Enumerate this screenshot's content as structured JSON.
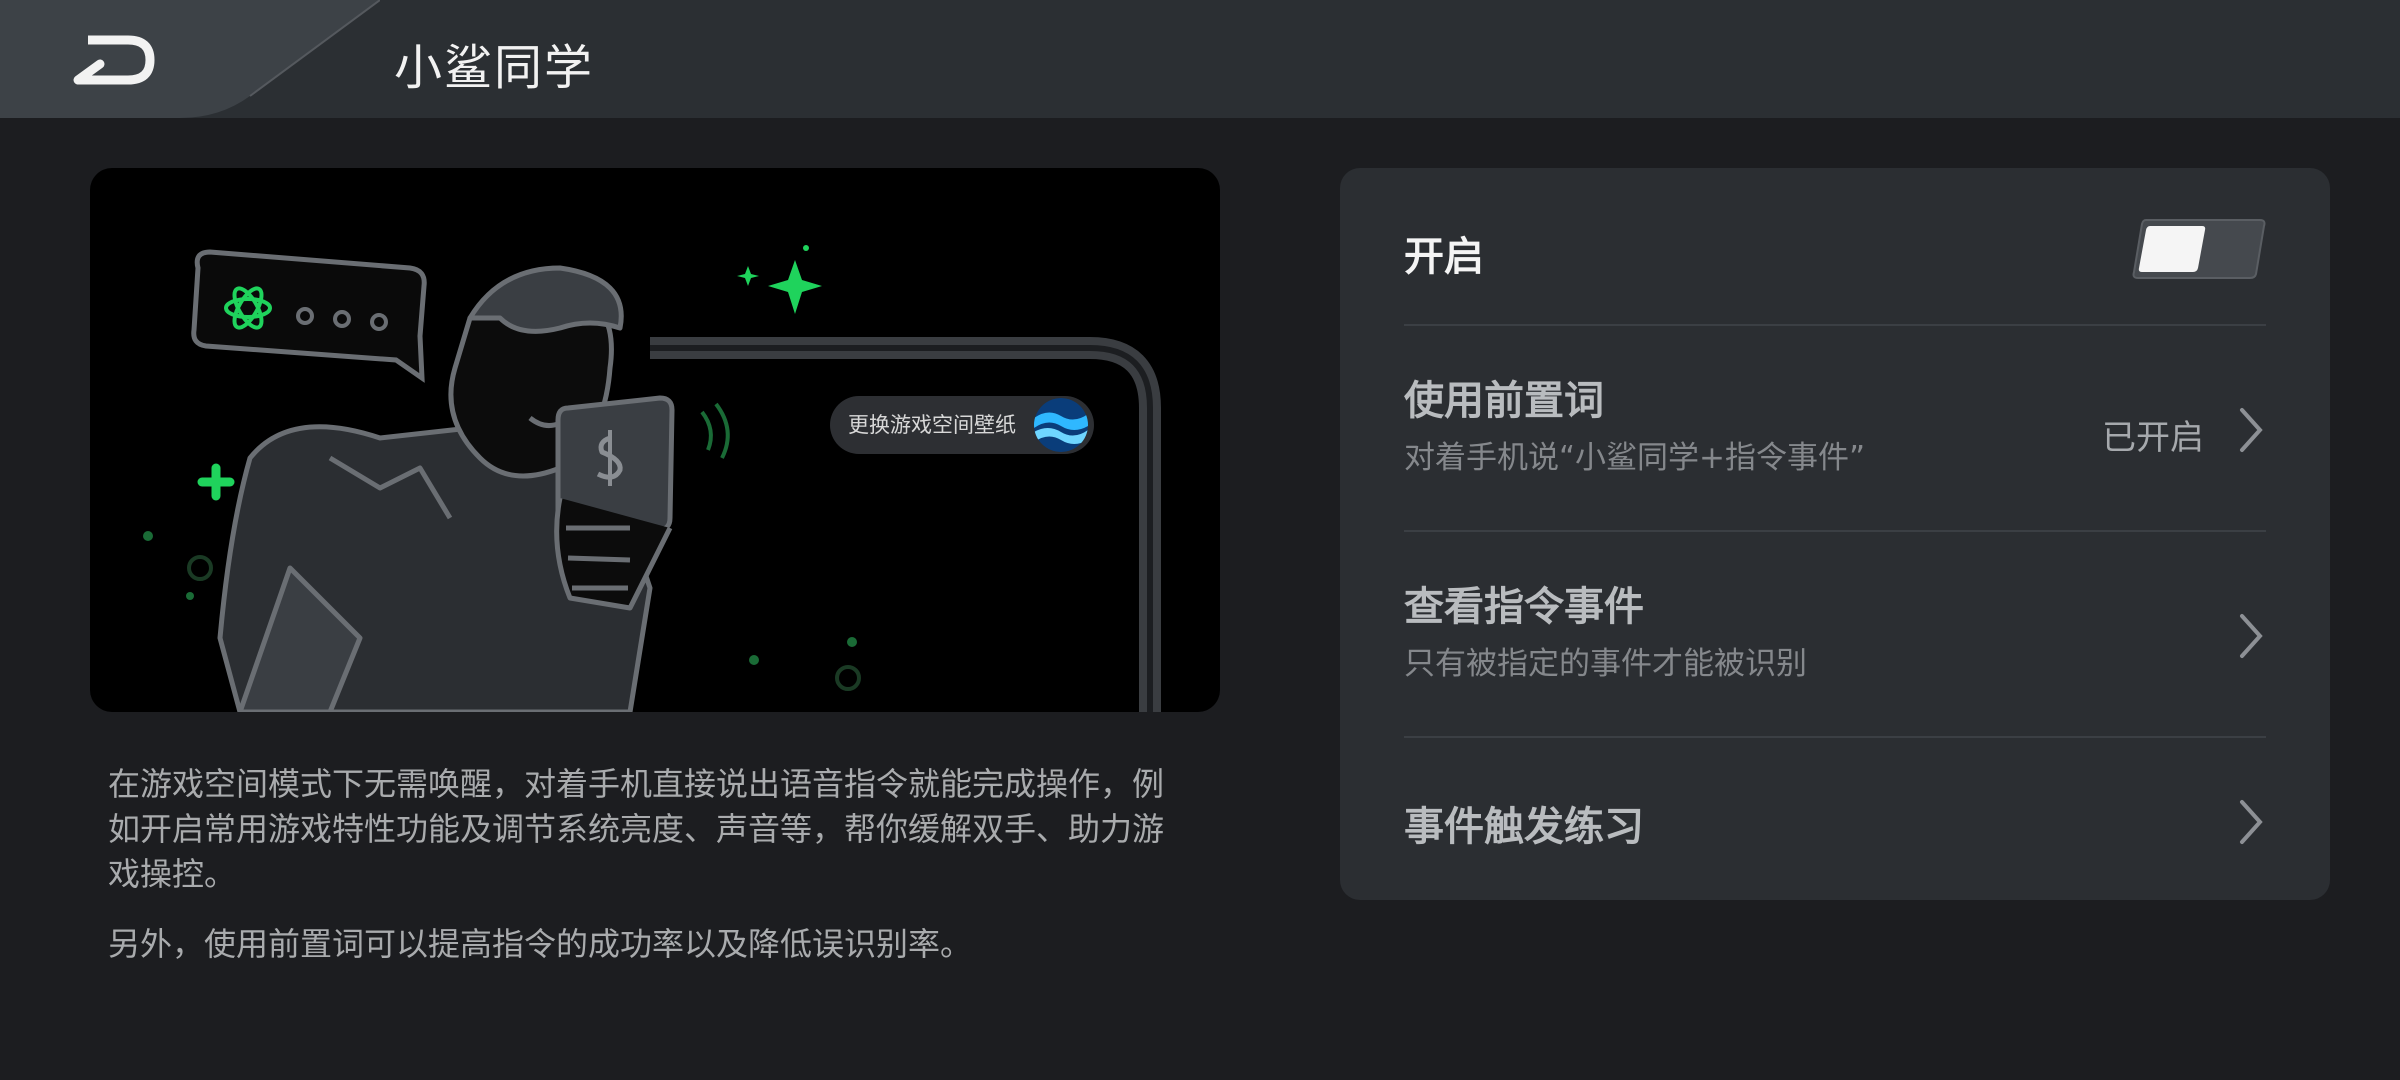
{
  "header": {
    "title": "小鲨同学",
    "back_icon": "back-arrow-icon"
  },
  "illustration": {
    "wallpaper_chip_label": "更换游戏空间壁纸"
  },
  "description": {
    "paragraph1": "在游戏空间模式下无需唤醒，对着手机直接说出语音指令就能完成操作，例如开启常用游戏特性功能及调节系统亮度、声音等，帮你缓解双手、助力游戏操控。",
    "paragraph2": "另外，使用前置词可以提高指令的成功率以及降低误识别率。"
  },
  "settings": {
    "toggle": {
      "label": "开启",
      "state": "off"
    },
    "items": [
      {
        "title": "使用前置词",
        "subtitle": "对着手机说“小鲨同学+指令事件”",
        "status": "已开启"
      },
      {
        "title": "查看指令事件",
        "subtitle": "只有被指定的事件才能被识别"
      },
      {
        "title": "事件触发练习"
      }
    ]
  },
  "colors": {
    "accent_green": "#1fd35c",
    "background": "#1c1d20",
    "card": "#2b2e32",
    "header": "#2b2f33"
  }
}
